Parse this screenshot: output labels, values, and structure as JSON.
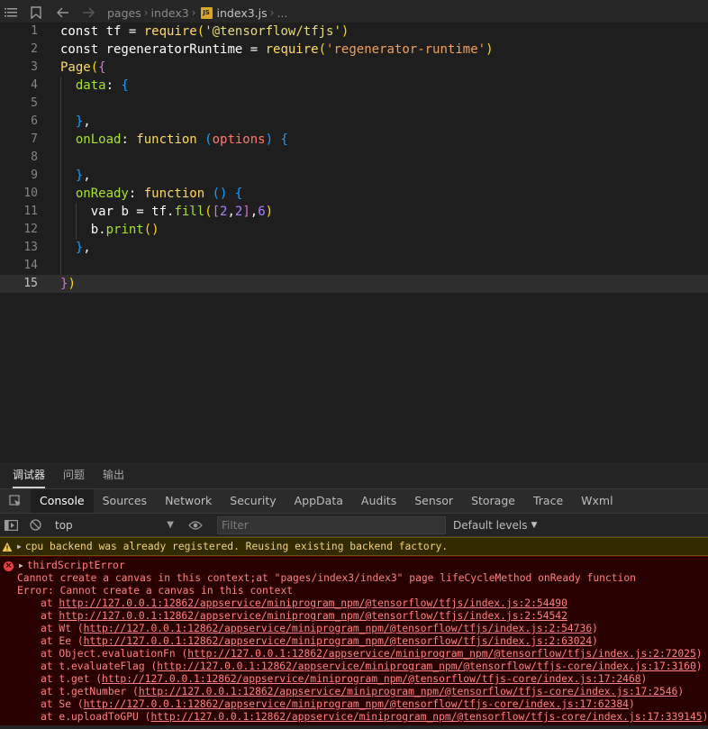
{
  "breadcrumb": {
    "items": [
      "pages",
      "index3",
      "index3.js",
      "..."
    ],
    "badge": "JS"
  },
  "editor": {
    "lines": [
      {
        "n": "1",
        "tokens": [
          [
            "const ",
            "t-kw"
          ],
          [
            "tf ",
            "t-var"
          ],
          [
            "= ",
            "t-pun"
          ],
          [
            "require",
            "t-fn"
          ],
          [
            "(",
            "t-b1"
          ],
          [
            "'@tensorflow/tfjs'",
            "t-str"
          ],
          [
            ")",
            "t-b1"
          ]
        ]
      },
      {
        "n": "2",
        "tokens": [
          [
            "const ",
            "t-kw"
          ],
          [
            "regeneratorRuntime ",
            "t-var"
          ],
          [
            "= ",
            "t-pun"
          ],
          [
            "require",
            "t-fn"
          ],
          [
            "(",
            "t-b1"
          ],
          [
            "'regenerator-runtime'",
            "t-str2"
          ],
          [
            ")",
            "t-b1"
          ]
        ]
      },
      {
        "n": "3",
        "tokens": [
          [
            "Page",
            "t-fn"
          ],
          [
            "(",
            "t-b1"
          ],
          [
            "{",
            "t-b2"
          ]
        ]
      },
      {
        "n": "4",
        "tokens": [
          [
            "  data",
            "t-prop"
          ],
          [
            ": ",
            "t-pun"
          ],
          [
            "{",
            "t-b3"
          ]
        ]
      },
      {
        "n": "5",
        "tokens": []
      },
      {
        "n": "6",
        "tokens": [
          [
            "  ",
            "t-pun"
          ],
          [
            "}",
            "t-b3"
          ],
          [
            ",",
            "t-pun"
          ]
        ]
      },
      {
        "n": "7",
        "tokens": [
          [
            "  onLoad",
            "t-prop"
          ],
          [
            ": ",
            "t-pun"
          ],
          [
            "function ",
            "t-fn"
          ],
          [
            "(",
            "t-b3"
          ],
          [
            "options",
            "t-param"
          ],
          [
            ") ",
            "t-b3"
          ],
          [
            "{",
            "t-b3"
          ]
        ]
      },
      {
        "n": "8",
        "tokens": []
      },
      {
        "n": "9",
        "tokens": [
          [
            "  ",
            "t-pun"
          ],
          [
            "}",
            "t-b3"
          ],
          [
            ",",
            "t-pun"
          ]
        ]
      },
      {
        "n": "10",
        "tokens": [
          [
            "  onReady",
            "t-prop"
          ],
          [
            ": ",
            "t-pun"
          ],
          [
            "function ",
            "t-fn"
          ],
          [
            "() ",
            "t-b3"
          ],
          [
            "{",
            "t-b3"
          ]
        ]
      },
      {
        "n": "11",
        "tokens": [
          [
            "    var ",
            "t-kw"
          ],
          [
            "b ",
            "t-var"
          ],
          [
            "= ",
            "t-pun"
          ],
          [
            "tf",
            "t-var"
          ],
          [
            ".",
            "t-pun"
          ],
          [
            "fill",
            "t-prop"
          ],
          [
            "(",
            "t-b1"
          ],
          [
            "[",
            "t-b2"
          ],
          [
            "2",
            "t-num"
          ],
          [
            ",",
            "t-pun"
          ],
          [
            "2",
            "t-num"
          ],
          [
            "]",
            "t-b2"
          ],
          [
            ",",
            "t-pun"
          ],
          [
            "6",
            "t-num"
          ],
          [
            ")",
            "t-b1"
          ]
        ]
      },
      {
        "n": "12",
        "tokens": [
          [
            "    b",
            "t-var"
          ],
          [
            ".",
            "t-pun"
          ],
          [
            "print",
            "t-prop"
          ],
          [
            "()",
            "t-b1"
          ]
        ]
      },
      {
        "n": "13",
        "tokens": [
          [
            "  ",
            "t-pun"
          ],
          [
            "}",
            "t-b3"
          ],
          [
            ",",
            "t-pun"
          ]
        ]
      },
      {
        "n": "14",
        "tokens": []
      },
      {
        "n": "15",
        "tokens": [
          [
            "}",
            "t-b2"
          ],
          [
            ")",
            "t-b1"
          ]
        ]
      }
    ]
  },
  "devtools": {
    "top_tabs": [
      "调试器",
      "问题",
      "输出"
    ],
    "panel_tabs": [
      "Console",
      "Sources",
      "Network",
      "Security",
      "AppData",
      "Audits",
      "Sensor",
      "Storage",
      "Trace",
      "Wxml"
    ],
    "context": "top",
    "filter_placeholder": "Filter",
    "levels": "Default levels"
  },
  "console": {
    "warning": "cpu backend was already registered. Reusing existing backend factory.",
    "error_title": "thirdScriptError",
    "error_lines": [
      "Cannot create a canvas in this context;at \"pages/index3/index3\" page lifeCycleMethod onReady function",
      "Error: Cannot create a canvas in this context"
    ],
    "stack": [
      {
        "pre": "at ",
        "fn": "",
        "url": "http://127.0.0.1:12862/appservice/miniprogram_npm/@tensorflow/tfjs/index.js:2:54490",
        "paren": false
      },
      {
        "pre": "at ",
        "fn": "",
        "url": "http://127.0.0.1:12862/appservice/miniprogram_npm/@tensorflow/tfjs/index.js:2:54542",
        "paren": false
      },
      {
        "pre": "at ",
        "fn": "Wt ",
        "url": "http://127.0.0.1:12862/appservice/miniprogram_npm/@tensorflow/tfjs/index.js:2:54736",
        "paren": true
      },
      {
        "pre": "at ",
        "fn": "Ee ",
        "url": "http://127.0.0.1:12862/appservice/miniprogram_npm/@tensorflow/tfjs/index.js:2:63024",
        "paren": true
      },
      {
        "pre": "at ",
        "fn": "Object.evaluationFn ",
        "url": "http://127.0.0.1:12862/appservice/miniprogram_npm/@tensorflow/tfjs/index.js:2:72025",
        "paren": true
      },
      {
        "pre": "at ",
        "fn": "t.evaluateFlag ",
        "url": "http://127.0.0.1:12862/appservice/miniprogram_npm/@tensorflow/tfjs-core/index.js:17:3160",
        "paren": true
      },
      {
        "pre": "at ",
        "fn": "t.get ",
        "url": "http://127.0.0.1:12862/appservice/miniprogram_npm/@tensorflow/tfjs-core/index.js:17:2468",
        "paren": true
      },
      {
        "pre": "at ",
        "fn": "t.getNumber ",
        "url": "http://127.0.0.1:12862/appservice/miniprogram_npm/@tensorflow/tfjs-core/index.js:17:2546",
        "paren": true
      },
      {
        "pre": "at ",
        "fn": "Se ",
        "url": "http://127.0.0.1:12862/appservice/miniprogram_npm/@tensorflow/tfjs-core/index.js:17:62384",
        "paren": true
      },
      {
        "pre": "at ",
        "fn": "e.uploadToGPU ",
        "url": "http://127.0.0.1:12862/appservice/miniprogram_npm/@tensorflow/tfjs-core/index.js:17:339145",
        "paren": true
      }
    ]
  },
  "colors": {
    "editor_bg": "#1e1e1e",
    "error_bg": "#290000",
    "error_text": "#ff8080",
    "warning_bg": "#332b00",
    "warning_text": "#f2d27c"
  }
}
